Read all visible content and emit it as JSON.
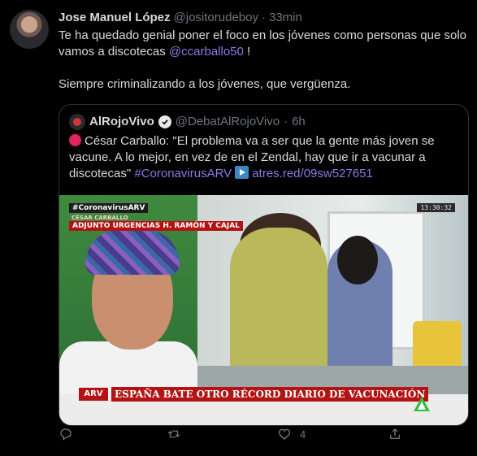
{
  "tweet": {
    "author_name": "Jose Manuel López",
    "author_handle": "@jositorudeboy",
    "separator": "·",
    "time": "33min",
    "text_part1": "Te ha quedado genial poner el foco en los jóvenes como personas que solo vamos a discotecas ",
    "mention": "@ccarballo50",
    "text_part1_end": " !",
    "text_part2": "Siempre criminalizando a los jóvenes, que vergüenza."
  },
  "quote": {
    "author_name": "AlRojoVivo",
    "author_handle": "@DebatAlRojoVivo",
    "separator": "·",
    "time": "6h",
    "text_main": "César Carballo: \"El problema va a ser que la gente más joven se vacune. A lo mejor, en vez de en el Zendal, hay que ir a vacunar a discotecas\" ",
    "hashtag": "#CoronavirusARV",
    "link": "atres.red/09sw527651",
    "media": {
      "tag_hashtag": "#CoronavirusARV",
      "tag_name": "CÉSAR CARBALLO",
      "tag_role": "ADJUNTO URGENCIAS H. RAMÓN Y CAJAL",
      "clock": "13:30:32",
      "logo": "ARV",
      "headline": "ESPAÑA BATE OTRO RÉCORD DIARIO DE VACUNACIÓN"
    }
  },
  "actions": {
    "reply_count": "",
    "retweet_count": "",
    "like_count": "4",
    "icons": [
      "reply-icon",
      "retweet-icon",
      "like-icon",
      "share-icon"
    ]
  },
  "colors": {
    "background": "#000000",
    "text": "#d9d9d9",
    "muted": "#6e767d",
    "accent": "#8c7ae6",
    "border": "#2f3336"
  }
}
